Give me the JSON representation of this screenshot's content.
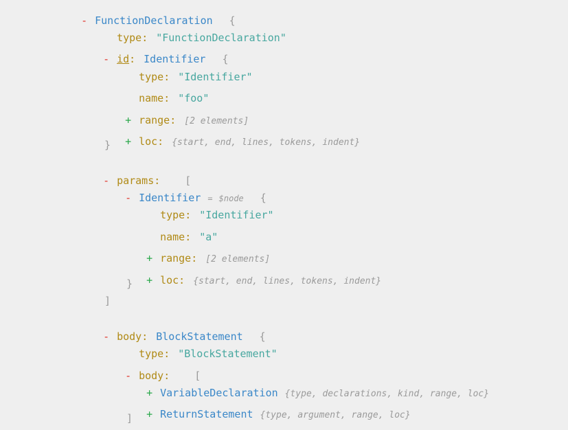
{
  "ui": {
    "collapse": "-",
    "expand": "+",
    "colon": ":",
    "eq": "="
  },
  "root": {
    "type_name": "FunctionDeclaration",
    "open": "{"
  },
  "root_type": {
    "key": "type",
    "value": "\"FunctionDeclaration\""
  },
  "id": {
    "key": "id",
    "type_name": "Identifier",
    "open": "{",
    "close": "}"
  },
  "id_type": {
    "key": "type",
    "value": "\"Identifier\""
  },
  "id_name": {
    "key": "name",
    "value": "\"foo\""
  },
  "id_range": {
    "key": "range",
    "summary": "[2 elements]"
  },
  "id_loc": {
    "key": "loc",
    "summary": "{start, end, lines, tokens, indent}"
  },
  "params": {
    "key": "params",
    "open": "[",
    "close": "]"
  },
  "param0": {
    "type_name": "Identifier",
    "alias": "$node",
    "open": "{",
    "close": "}"
  },
  "param0_type": {
    "key": "type",
    "value": "\"Identifier\""
  },
  "param0_name": {
    "key": "name",
    "value": "\"a\""
  },
  "param0_range": {
    "key": "range",
    "summary": "[2 elements]"
  },
  "param0_loc": {
    "key": "loc",
    "summary": "{start, end, lines, tokens, indent}"
  },
  "body": {
    "key": "body",
    "type_name": "BlockStatement",
    "open": "{"
  },
  "body_type": {
    "key": "type",
    "value": "\"BlockStatement\""
  },
  "body_body": {
    "key": "body",
    "open": "[",
    "close": "]"
  },
  "stmt0": {
    "type_name": "VariableDeclaration",
    "summary": "{type, declarations, kind, range, loc}"
  },
  "stmt1": {
    "type_name": "ReturnStatement",
    "summary": "{type, argument, range, loc}"
  }
}
